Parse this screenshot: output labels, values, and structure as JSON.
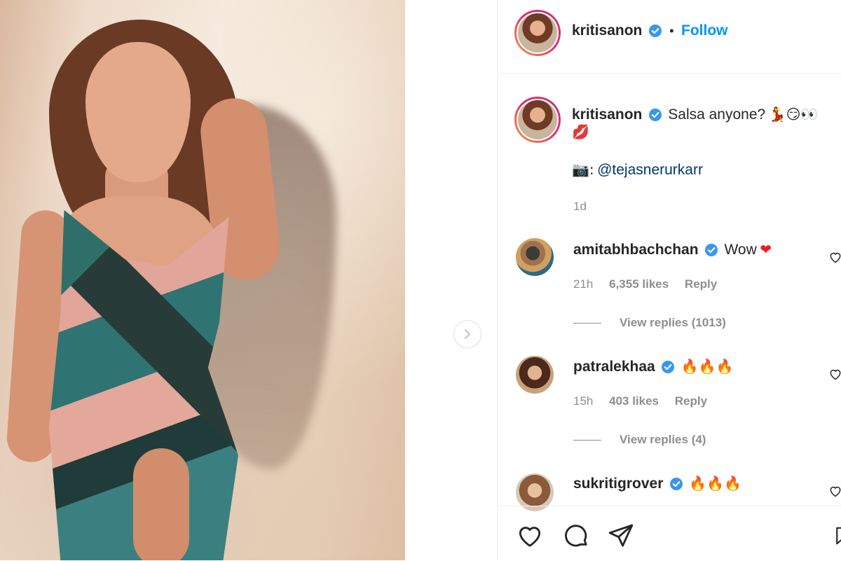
{
  "post": {
    "author": "kritisanon",
    "follow_label": "Follow",
    "separator": "•",
    "caption_text": "Salsa anyone?",
    "caption_emojis": "💃😏👀",
    "caption_line2_emoji": "💋",
    "credit_prefix": "📷:",
    "credit_handle": "@tejasnerurkarr",
    "time_ago": "1d"
  },
  "comments": [
    {
      "username": "amitabhbachchan",
      "text": "Wow",
      "emoji": "❤",
      "time": "21h",
      "likes": "6,355 likes",
      "reply_label": "Reply",
      "view_replies": "View replies (1013)"
    },
    {
      "username": "patralekhaa",
      "text": "",
      "emoji": "🔥🔥🔥",
      "time": "15h",
      "likes": "403 likes",
      "reply_label": "Reply",
      "view_replies": "View replies (4)"
    },
    {
      "username": "sukritigrover",
      "text": "",
      "emoji": "🔥🔥🔥"
    }
  ],
  "colors": {
    "accent": "#0095f6",
    "verified": "#3897f0",
    "muted": "#8e8e8e",
    "heart": "#ed4956"
  },
  "icons": [
    "verified-badge-icon",
    "chevron-right-icon",
    "heart-icon",
    "comment-icon",
    "share-icon",
    "bookmark-icon"
  ]
}
